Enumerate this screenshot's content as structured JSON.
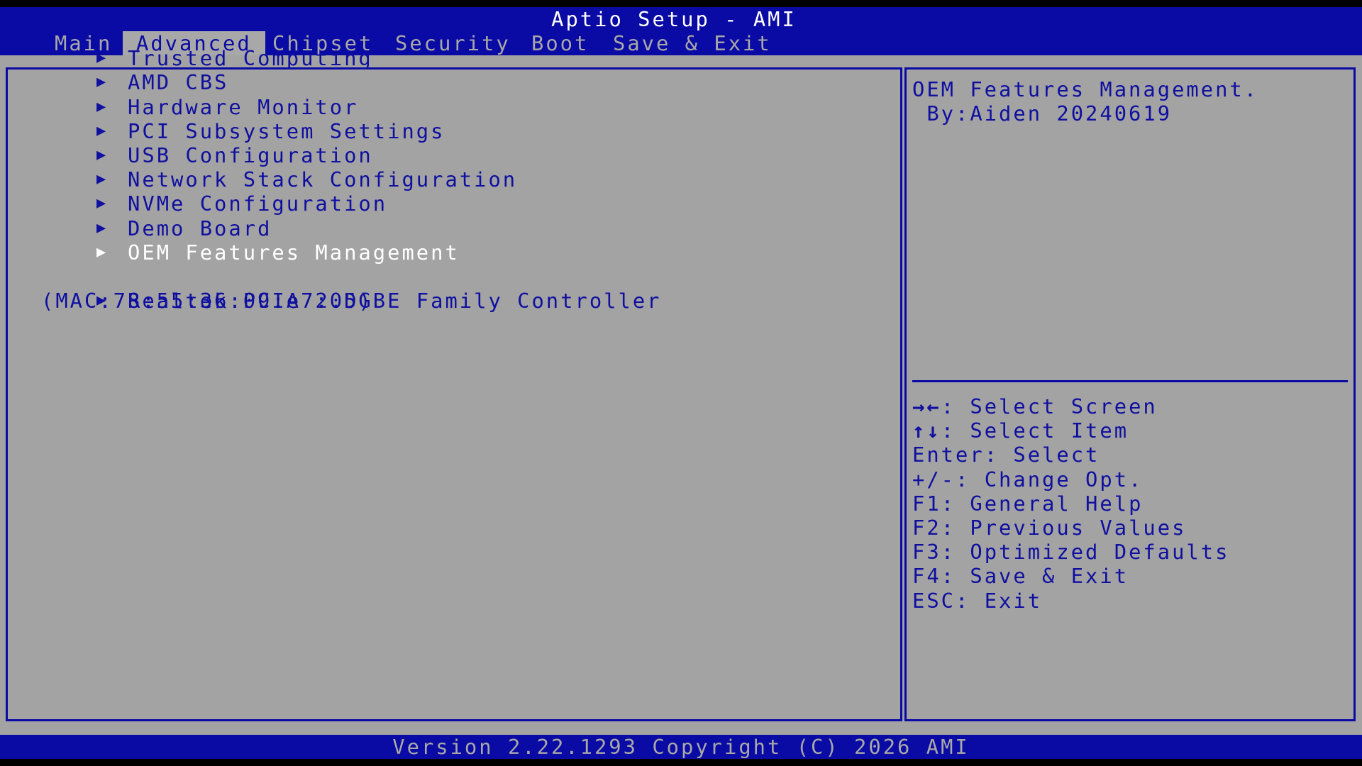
{
  "header": {
    "title": "Aptio Setup - AMI",
    "tabs": [
      {
        "label": "Main"
      },
      {
        "label": "Advanced"
      },
      {
        "label": "Chipset"
      },
      {
        "label": "Security"
      },
      {
        "label": "Boot"
      },
      {
        "label": "Save & Exit"
      }
    ],
    "active_tab": "Advanced"
  },
  "menu": {
    "items": [
      {
        "label": "Trusted Computing"
      },
      {
        "label": "AMD CBS"
      },
      {
        "label": "Hardware Monitor"
      },
      {
        "label": "PCI Subsystem Settings"
      },
      {
        "label": "USB Configuration"
      },
      {
        "label": "Network Stack Configuration"
      },
      {
        "label": "NVMe Configuration"
      },
      {
        "label": "Demo Board"
      },
      {
        "label": "OEM Features Management"
      }
    ],
    "selected": "OEM Features Management",
    "extra_item": {
      "label": "Realtek PCIe 2.5GBE Family Controller",
      "sub": "(MAC:78:55:36:09:A7:0D)"
    },
    "arrow_icon": "▶"
  },
  "help": {
    "line1": "OEM Features Management.",
    "line2": " By:Aiden 20240619"
  },
  "keys": [
    {
      "key": "→←",
      "desc": ": Select Screen"
    },
    {
      "key": "↑↓",
      "desc": ": Select Item"
    },
    {
      "key": "Enter",
      "desc": ": Select"
    },
    {
      "key": "+/-",
      "desc": ": Change Opt."
    },
    {
      "key": "F1",
      "desc": ": General Help"
    },
    {
      "key": "F2",
      "desc": ": Previous Values"
    },
    {
      "key": "F3",
      "desc": ": Optimized Defaults"
    },
    {
      "key": "F4",
      "desc": ": Save & Exit"
    },
    {
      "key": "ESC",
      "desc": ": Exit"
    }
  ],
  "footer": {
    "text": "Version 2.22.1293 Copyright (C) 2026 AMI"
  },
  "colors": {
    "bios_blue": "#0a0aa4",
    "panel_gray": "#a3a3a3",
    "highlight_white": "#ffffff",
    "text_blue": "#0f0fa0"
  }
}
